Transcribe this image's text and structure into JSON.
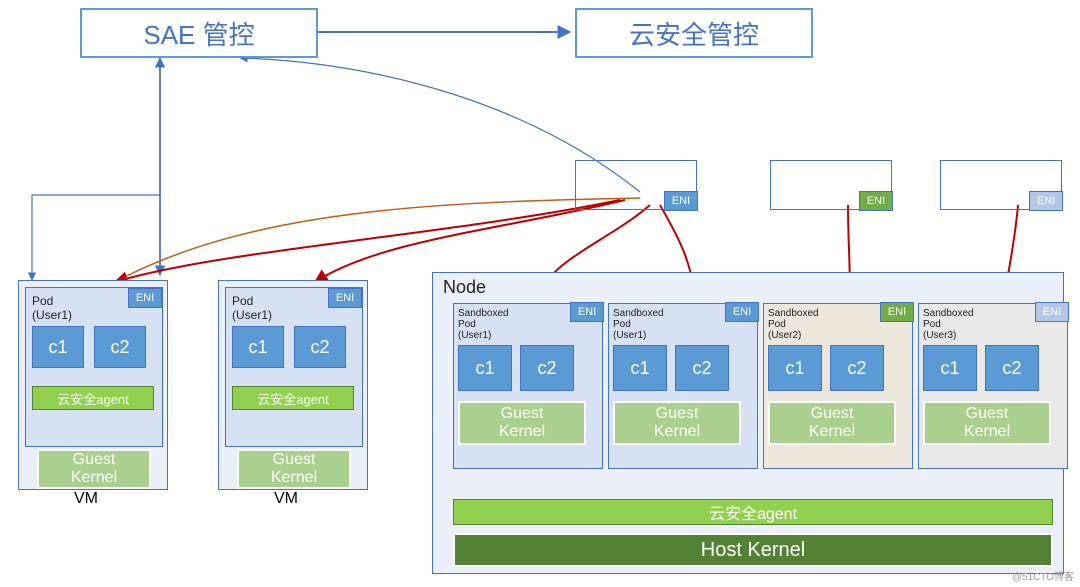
{
  "top": {
    "sae": "SAE 管控",
    "cloud_sec": "云安全管控"
  },
  "eni_label": "ENI",
  "vm1": {
    "pod_label": "Pod",
    "user": "(User1)",
    "c1": "c1",
    "c2": "c2",
    "agent": "云安全agent",
    "gk1": "Guest",
    "gk2": "Kernel",
    "label": "VM"
  },
  "vm2": {
    "pod_label": "Pod",
    "user": "(User1)",
    "c1": "c1",
    "c2": "c2",
    "agent": "云安全agent",
    "gk1": "Guest",
    "gk2": "Kernel",
    "label": "VM"
  },
  "node": {
    "title": "Node",
    "agent": "云安全agent",
    "host_kernel": "Host Kernel",
    "sp1": {
      "l1": "Sandboxed",
      "l2": "Pod",
      "user": "(User1)",
      "c1": "c1",
      "c2": "c2",
      "gk1": "Guest",
      "gk2": "Kernel"
    },
    "sp2": {
      "l1": "Sandboxed",
      "l2": "Pod",
      "user": "(User1)",
      "c1": "c1",
      "c2": "c2",
      "gk1": "Guest",
      "gk2": "Kernel"
    },
    "sp3": {
      "l1": "Sandboxed",
      "l2": "Pod",
      "user": "(User2)",
      "c1": "c1",
      "c2": "c2",
      "gk1": "Guest",
      "gk2": "Kernel"
    },
    "sp4": {
      "l1": "Sandboxed",
      "l2": "Pod",
      "user": "(User3)",
      "c1": "c1",
      "c2": "c2",
      "gk1": "Guest",
      "gk2": "Kernel"
    }
  },
  "watermark": "@51CTO博客"
}
